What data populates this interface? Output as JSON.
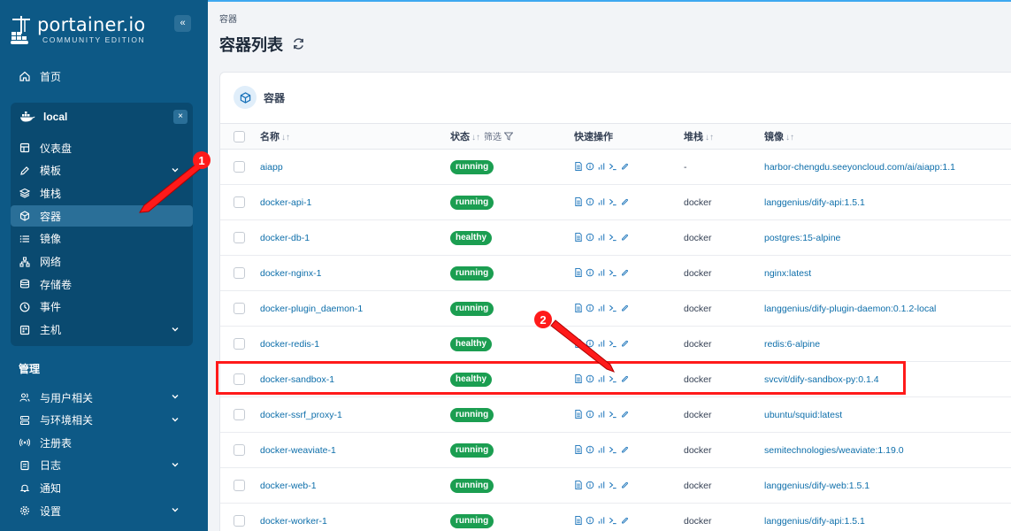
{
  "sidebar": {
    "logo_text": "portainer.io",
    "logo_sub": "COMMUNITY EDITION",
    "collapse_glyph": "«",
    "home": "首页",
    "env_name": "local",
    "env_close": "×",
    "env_items": [
      {
        "label": "仪表盘",
        "icon": "dashboard-icon"
      },
      {
        "label": "模板",
        "icon": "edit-icon",
        "has_chevron": true
      },
      {
        "label": "堆栈",
        "icon": "layers-icon"
      },
      {
        "label": "容器",
        "icon": "cube-icon",
        "active": true
      },
      {
        "label": "镜像",
        "icon": "list-icon"
      },
      {
        "label": "网络",
        "icon": "network-icon"
      },
      {
        "label": "存储卷",
        "icon": "database-icon"
      },
      {
        "label": "事件",
        "icon": "clock-icon"
      },
      {
        "label": "主机",
        "icon": "grid-icon",
        "has_chevron": true
      }
    ],
    "section_manage": "管理",
    "manage_items": [
      {
        "label": "与用户相关",
        "icon": "users-icon",
        "has_chevron": true
      },
      {
        "label": "与环境相关",
        "icon": "server-icon",
        "has_chevron": true
      },
      {
        "label": "注册表",
        "icon": "radio-icon"
      },
      {
        "label": "日志",
        "icon": "book-icon",
        "has_chevron": true
      },
      {
        "label": "通知",
        "icon": "bell-icon"
      },
      {
        "label": "设置",
        "icon": "gear-icon",
        "has_chevron": true
      }
    ]
  },
  "header": {
    "breadcrumb": "容器",
    "title": "容器列表"
  },
  "panel": {
    "title": "容器",
    "columns": {
      "name": "名称",
      "state": "状态",
      "filter": "筛选",
      "quick_actions": "快速操作",
      "stack": "堆栈",
      "image": "镜像"
    }
  },
  "containers": [
    {
      "name": "aiapp",
      "state": "running",
      "stack": "-",
      "image": "harbor-chengdu.seeyoncloud.com/ai/aiapp:1.1"
    },
    {
      "name": "docker-api-1",
      "state": "running",
      "stack": "docker",
      "image": "langgenius/dify-api:1.5.1"
    },
    {
      "name": "docker-db-1",
      "state": "healthy",
      "stack": "docker",
      "image": "postgres:15-alpine"
    },
    {
      "name": "docker-nginx-1",
      "state": "running",
      "stack": "docker",
      "image": "nginx:latest"
    },
    {
      "name": "docker-plugin_daemon-1",
      "state": "running",
      "stack": "docker",
      "image": "langgenius/dify-plugin-daemon:0.1.2-local"
    },
    {
      "name": "docker-redis-1",
      "state": "healthy",
      "stack": "docker",
      "image": "redis:6-alpine"
    },
    {
      "name": "docker-sandbox-1",
      "state": "healthy",
      "stack": "docker",
      "image": "svcvit/dify-sandbox-py:0.1.4"
    },
    {
      "name": "docker-ssrf_proxy-1",
      "state": "running",
      "stack": "docker",
      "image": "ubuntu/squid:latest"
    },
    {
      "name": "docker-weaviate-1",
      "state": "running",
      "stack": "docker",
      "image": "semitechnologies/weaviate:1.19.0"
    },
    {
      "name": "docker-web-1",
      "state": "running",
      "stack": "docker",
      "image": "langgenius/dify-web:1.5.1"
    },
    {
      "name": "docker-worker-1",
      "state": "running",
      "stack": "docker",
      "image": "langgenius/dify-api:1.5.1"
    }
  ],
  "annotations": {
    "marker_1": "1",
    "marker_2": "2",
    "color": "#ff1a1a"
  },
  "colors": {
    "sidebar": "#0d5986",
    "badge": "#1b9e51",
    "link": "#0d6eaa"
  }
}
